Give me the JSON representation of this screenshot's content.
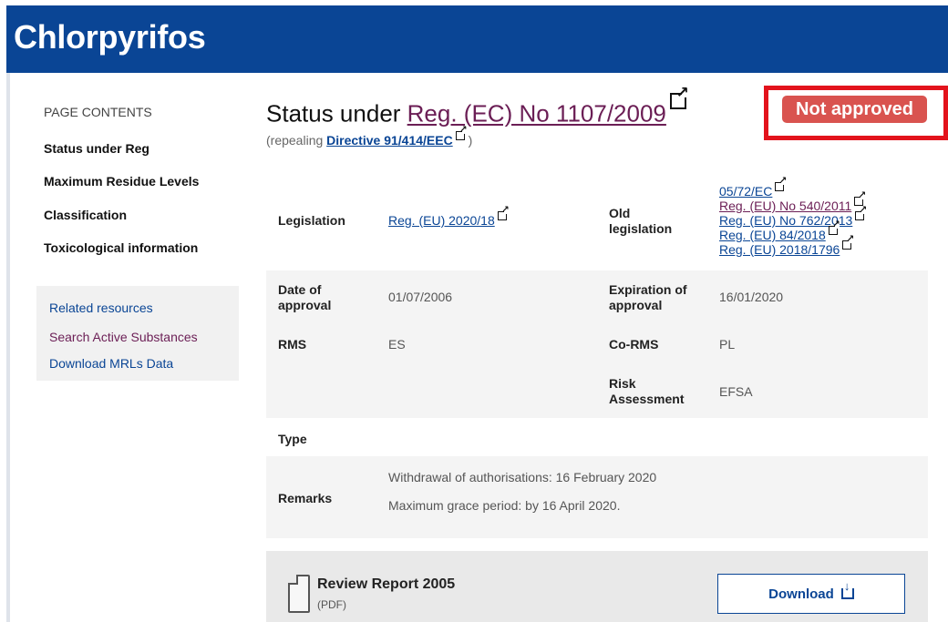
{
  "page": {
    "title": "Chlorpyrifos",
    "status_badge": "Not approved"
  },
  "sidebar": {
    "heading": "PAGE CONTENTS",
    "items": [
      {
        "label": "Status under Reg"
      },
      {
        "label": "Maximum Residue Levels"
      },
      {
        "label": "Classification"
      },
      {
        "label": "Toxicological information"
      }
    ],
    "related": {
      "title": "Related resources",
      "links": [
        {
          "label": "Search Active Substances"
        },
        {
          "label": "Download MRLs Data"
        }
      ]
    }
  },
  "status": {
    "heading_prefix": "Status under ",
    "regulation_link": "Reg. (EC) No 1107/2009",
    "repealing_prefix": "(repealing ",
    "repealing_link": "Directive 91/414/EEC",
    "repealing_suffix": " )"
  },
  "table": {
    "legislation_label": "Legislation",
    "legislation_value": "Reg. (EU) 2020/18",
    "old_legislation_label": "Old legislation",
    "old_legislation_links": [
      "05/72/EC",
      "Reg. (EU) No 540/2011",
      "Reg. (EU) No 762/2013",
      "Reg. (EU) 84/2018",
      "Reg. (EU) 2018/1796"
    ],
    "date_of_approval_label": "Date of approval",
    "date_of_approval_value": "01/07/2006",
    "expiration_label": "Expiration of approval",
    "expiration_value": "16/01/2020",
    "rms_label": "RMS",
    "rms_value": "ES",
    "co_rms_label": "Co-RMS",
    "co_rms_value": "PL",
    "risk_assessment_label": "Risk Assessment",
    "risk_assessment_value": "EFSA",
    "type_label": "Type",
    "remarks_label": "Remarks",
    "remarks_lines": [
      "Withdrawal of authorisations: 16 February 2020",
      "Maximum grace period: by 16 April 2020."
    ]
  },
  "review": {
    "title": "Review Report 2005",
    "format": "(PDF)",
    "download_label": "Download"
  },
  "colors": {
    "banner": "#0a4595",
    "badge": "#d9534f",
    "highlight": "#e3131c",
    "link": "#0a4595",
    "visited_link": "#6b1e55"
  }
}
